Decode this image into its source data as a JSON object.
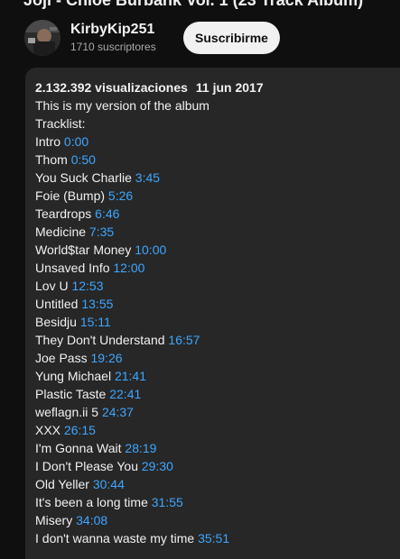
{
  "video": {
    "title": "Joji - Chloe Burbank Vol. 1 (23 Track Album)"
  },
  "channel": {
    "name": "KirbyKip251",
    "subscribers": "1710 suscriptores",
    "subscribe_label": "Suscribirme",
    "avatar_icon": "channel-avatar"
  },
  "description": {
    "views": "2.132.392 visualizaciones",
    "date": "11 jun 2017",
    "line1": "This is my version of the album",
    "line2": "Tracklist:",
    "tracks": [
      {
        "title": "Intro",
        "time": "0:00"
      },
      {
        "title": "Thom",
        "time": "0:50"
      },
      {
        "title": "You Suck Charlie",
        "time": "3:45"
      },
      {
        "title": "Foie (Bump)",
        "time": "5:26"
      },
      {
        "title": "Teardrops",
        "time": "6:46"
      },
      {
        "title": "Medicine",
        "time": "7:35"
      },
      {
        "title": "World$tar Money",
        "time": "10:00"
      },
      {
        "title": "Unsaved Info",
        "time": "12:00"
      },
      {
        "title": "Lov U",
        "time": "12:53"
      },
      {
        "title": "Untitled",
        "time": "13:55"
      },
      {
        "title": "Besidju",
        "time": "15:11"
      },
      {
        "title": "They Don't Understand",
        "time": "16:57"
      },
      {
        "title": "Joe Pass",
        "time": "19:26"
      },
      {
        "title": "Yung Michael",
        "time": "21:41"
      },
      {
        "title": "Plastic Taste",
        "time": "22:41"
      },
      {
        "title": "weflagn.ii 5",
        "time": "24:37"
      },
      {
        "title": "XXX",
        "time": "26:15"
      },
      {
        "title": "I'm Gonna Wait",
        "time": "28:19"
      },
      {
        "title": "I Don't Please You",
        "time": "29:30"
      },
      {
        "title": "Old Yeller",
        "time": "30:44"
      },
      {
        "title": "It's been a long time",
        "time": "31:55"
      },
      {
        "title": "Misery",
        "time": "34:08"
      },
      {
        "title": "I don't wanna waste my time",
        "time": "35:51"
      }
    ]
  },
  "colors": {
    "background": "#0f0f0f",
    "panel": "#272727",
    "timestamp_link": "#3ea6ff",
    "button_bg": "#f1f1f1"
  }
}
